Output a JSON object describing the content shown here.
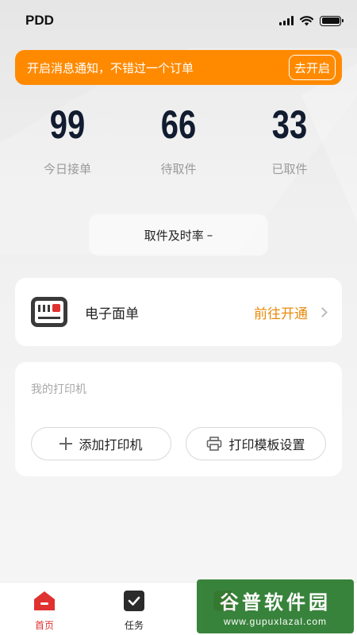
{
  "status_bar": {
    "carrier": "PDD"
  },
  "notice": {
    "text": "开启消息通知，不错过一个订单",
    "button": "去开启"
  },
  "stats": [
    {
      "value": "99",
      "label": "今日接单"
    },
    {
      "value": "66",
      "label": "待取件"
    },
    {
      "value": "33",
      "label": "已取件"
    }
  ],
  "rate": {
    "label": "取件及时率",
    "value": "–"
  },
  "waybill": {
    "title": "电子面单",
    "action": "前往开通"
  },
  "printer": {
    "title": "我的打印机",
    "add_button": "添加打印机",
    "template_button": "打印模板设置"
  },
  "tabbar": {
    "items": [
      {
        "label": "首页",
        "icon": "home-icon",
        "active": true
      },
      {
        "label": "任务",
        "icon": "task-check-icon",
        "active": false
      },
      {
        "label": "",
        "icon": "profile-icon",
        "active": false
      }
    ]
  },
  "watermark": {
    "title": "谷普软件园",
    "url": "www.gupuxlazal.com"
  },
  "colors": {
    "accent": "#ff8a00",
    "active": "#e03131",
    "stat_number": "#111c30"
  }
}
